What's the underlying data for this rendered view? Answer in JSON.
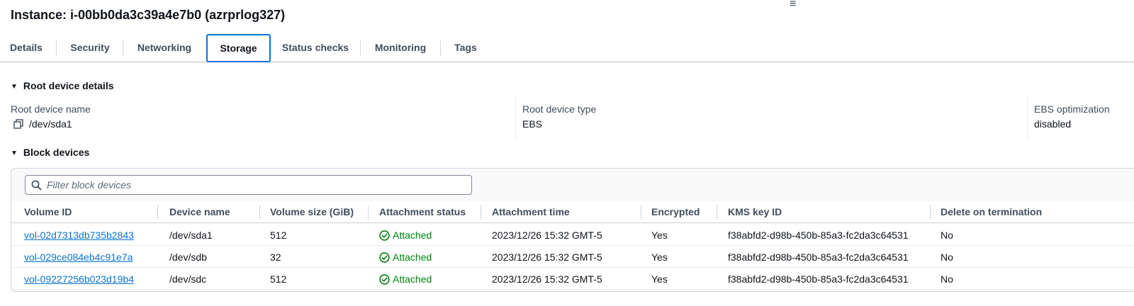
{
  "header": {
    "title": "Instance: i-00bb0da3c39a4e7b0 (azrprlog327)",
    "handle_glyph": "≡"
  },
  "tabs": [
    {
      "label": "Details"
    },
    {
      "label": "Security"
    },
    {
      "label": "Networking"
    },
    {
      "label": "Storage",
      "active": true
    },
    {
      "label": "Status checks"
    },
    {
      "label": "Monitoring"
    },
    {
      "label": "Tags"
    }
  ],
  "root_device": {
    "section_title": "Root device details",
    "name_label": "Root device name",
    "name_value": "/dev/sda1",
    "type_label": "Root device type",
    "type_value": "EBS",
    "ebs_label": "EBS optimization",
    "ebs_value": "disabled"
  },
  "block_devices": {
    "section_title": "Block devices",
    "filter_placeholder": "Filter block devices",
    "columns": [
      "Volume ID",
      "Device name",
      "Volume size (GiB)",
      "Attachment status",
      "Attachment time",
      "Encrypted",
      "KMS key ID",
      "Delete on termination"
    ],
    "rows": [
      {
        "volume_id": "vol-02d7313db735b2843",
        "device": "/dev/sda1",
        "size": "512",
        "status": "Attached",
        "time": "2023/12/26 15:32 GMT-5",
        "encrypted": "Yes",
        "kms": "f38abfd2-d98b-450b-85a3-fc2da3c64531",
        "delete": "No"
      },
      {
        "volume_id": "vol-029ce084eb4c91e7a",
        "device": "/dev/sdb",
        "size": "32",
        "status": "Attached",
        "time": "2023/12/26 15:32 GMT-5",
        "encrypted": "Yes",
        "kms": "f38abfd2-d98b-450b-85a3-fc2da3c64531",
        "delete": "No"
      },
      {
        "volume_id": "vol-09227256b023d19b4",
        "device": "/dev/sdc",
        "size": "512",
        "status": "Attached",
        "time": "2023/12/26 15:32 GMT-5",
        "encrypted": "Yes",
        "kms": "f38abfd2-d98b-450b-85a3-fc2da3c64531",
        "delete": "No"
      }
    ]
  },
  "colors": {
    "link": "#0972d3",
    "success": "#037f0c",
    "text": "#0f141a",
    "muted": "#414d5c"
  }
}
